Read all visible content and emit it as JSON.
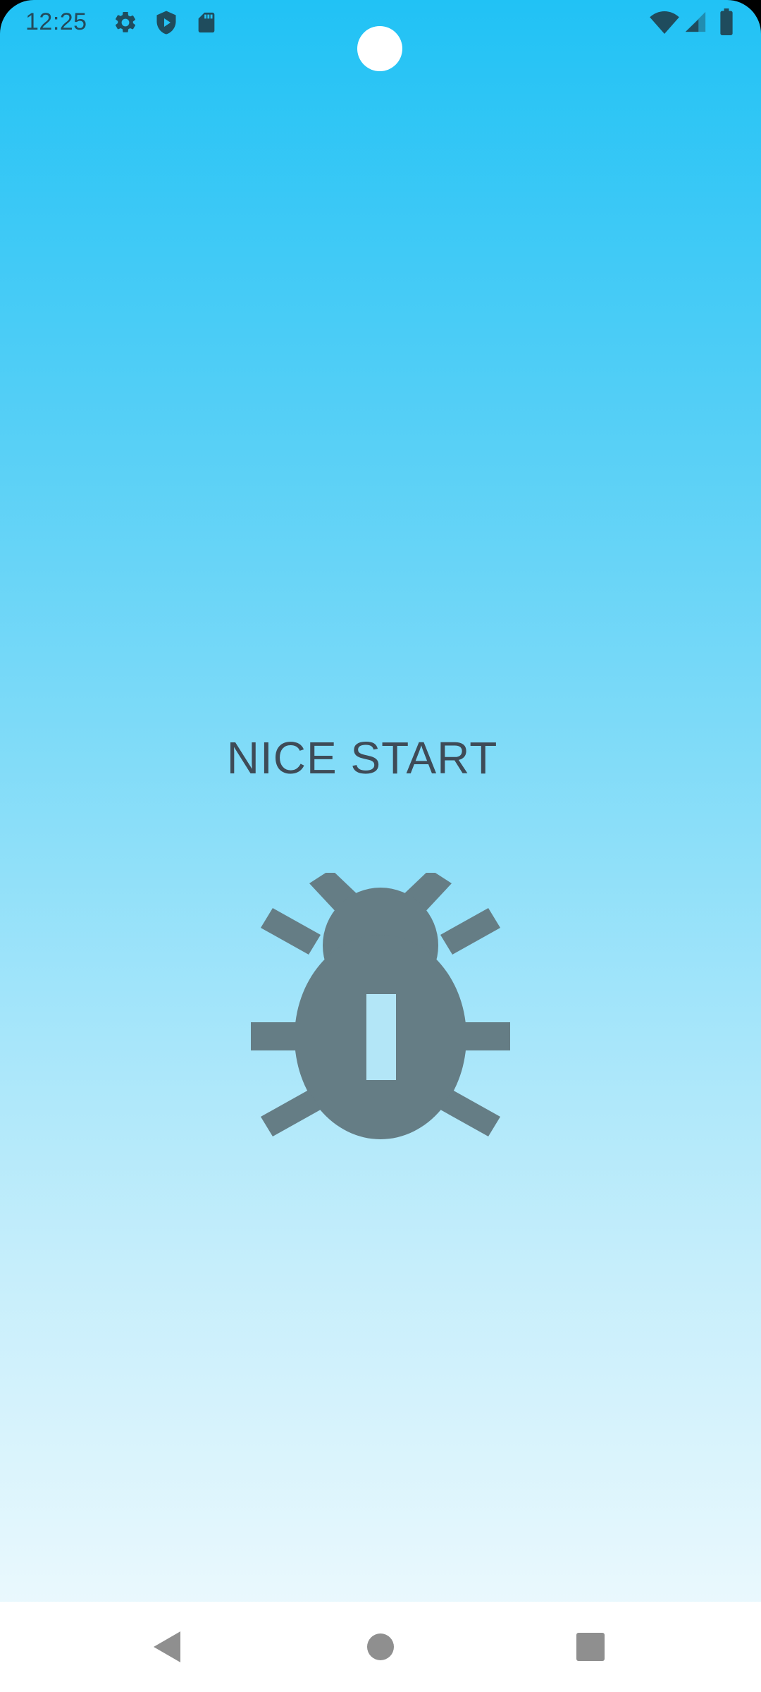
{
  "status_bar": {
    "time": "12:25",
    "left_icons": [
      "gear-icon",
      "shield-play-icon",
      "sd-card-icon"
    ],
    "right_icons": [
      "wifi-icon",
      "cell-signal-icon",
      "battery-icon"
    ]
  },
  "splash": {
    "title": "NICE START",
    "logo_icon": "bug-icon"
  },
  "nav_bar": {
    "buttons": [
      "back-icon",
      "home-icon",
      "recents-icon"
    ]
  },
  "colors": {
    "gradient_top": "#21c2f5",
    "gradient_bottom": "#f3fbfe",
    "title_text": "#3e4b57",
    "bug": "#657d85",
    "status_icons": "#1f4c5d",
    "nav_icons": "#8f8f8f"
  }
}
